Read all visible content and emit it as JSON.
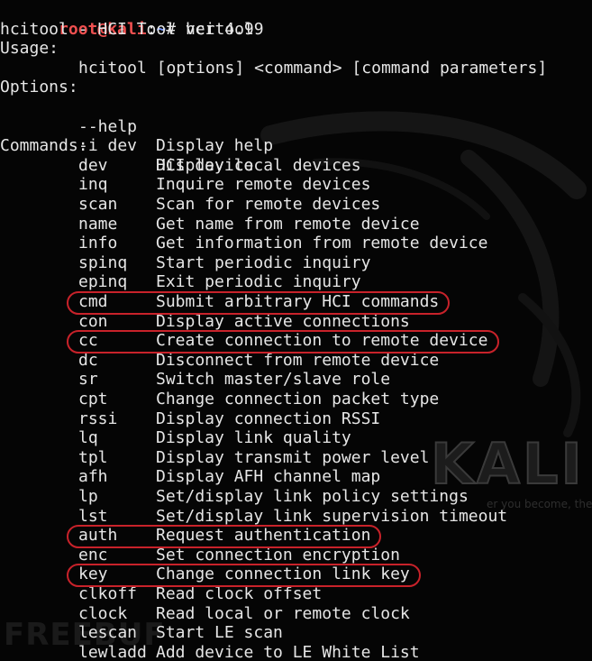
{
  "prompt": {
    "user_host": "root@kali",
    "colon": ":",
    "path": "~",
    "hash": "# ",
    "command": "hcitool"
  },
  "header": {
    "title": "hcitool - HCI Tool ver 4.99",
    "usage_label": "Usage:",
    "usage_text": "hcitool [options] <command> [command parameters]",
    "options_label": "Options:",
    "options": [
      {
        "name": "--help",
        "desc": "Display help"
      },
      {
        "name": "-i dev",
        "desc": "HCI device"
      }
    ],
    "commands_label": "Commands:"
  },
  "commands": [
    {
      "name": "dev",
      "desc": "Display local devices",
      "highlighted": false
    },
    {
      "name": "inq",
      "desc": "Inquire remote devices",
      "highlighted": false
    },
    {
      "name": "scan",
      "desc": "Scan for remote devices",
      "highlighted": false
    },
    {
      "name": "name",
      "desc": "Get name from remote device",
      "highlighted": false
    },
    {
      "name": "info",
      "desc": "Get information from remote device",
      "highlighted": false
    },
    {
      "name": "spinq",
      "desc": "Start periodic inquiry",
      "highlighted": false
    },
    {
      "name": "epinq",
      "desc": "Exit periodic inquiry",
      "highlighted": false
    },
    {
      "name": "cmd",
      "desc": "Submit arbitrary HCI commands",
      "highlighted": true
    },
    {
      "name": "con",
      "desc": "Display active connections",
      "highlighted": false
    },
    {
      "name": "cc",
      "desc": "Create connection to remote device",
      "highlighted": true
    },
    {
      "name": "dc",
      "desc": "Disconnect from remote device",
      "highlighted": false
    },
    {
      "name": "sr",
      "desc": "Switch master/slave role",
      "highlighted": false
    },
    {
      "name": "cpt",
      "desc": "Change connection packet type",
      "highlighted": false
    },
    {
      "name": "rssi",
      "desc": "Display connection RSSI",
      "highlighted": false
    },
    {
      "name": "lq",
      "desc": "Display link quality",
      "highlighted": false
    },
    {
      "name": "tpl",
      "desc": "Display transmit power level",
      "highlighted": false
    },
    {
      "name": "afh",
      "desc": "Display AFH channel map",
      "highlighted": false
    },
    {
      "name": "lp",
      "desc": "Set/display link policy settings",
      "highlighted": false
    },
    {
      "name": "lst",
      "desc": "Set/display link supervision timeout",
      "highlighted": false
    },
    {
      "name": "auth",
      "desc": "Request authentication",
      "highlighted": true
    },
    {
      "name": "enc",
      "desc": "Set connection encryption",
      "highlighted": false
    },
    {
      "name": "key",
      "desc": "Change connection link key",
      "highlighted": true
    },
    {
      "name": "clkoff",
      "desc": "Read clock offset",
      "highlighted": false
    },
    {
      "name": "clock",
      "desc": "Read local or remote clock",
      "highlighted": false
    },
    {
      "name": "lescan",
      "desc": "Start LE scan",
      "highlighted": false
    },
    {
      "name": "lewladd",
      "desc": "Add device to LE White List",
      "highlighted": false
    }
  ],
  "watermarks": {
    "kali": "KALI LI",
    "tagline": "er you become, the m",
    "freebuf": "FREEBUF"
  },
  "colors": {
    "background": "#050505",
    "text": "#e6e6e6",
    "prompt_user": "#f05050",
    "prompt_path": "#6f8ff5",
    "highlight_oval": "#c8222a"
  }
}
